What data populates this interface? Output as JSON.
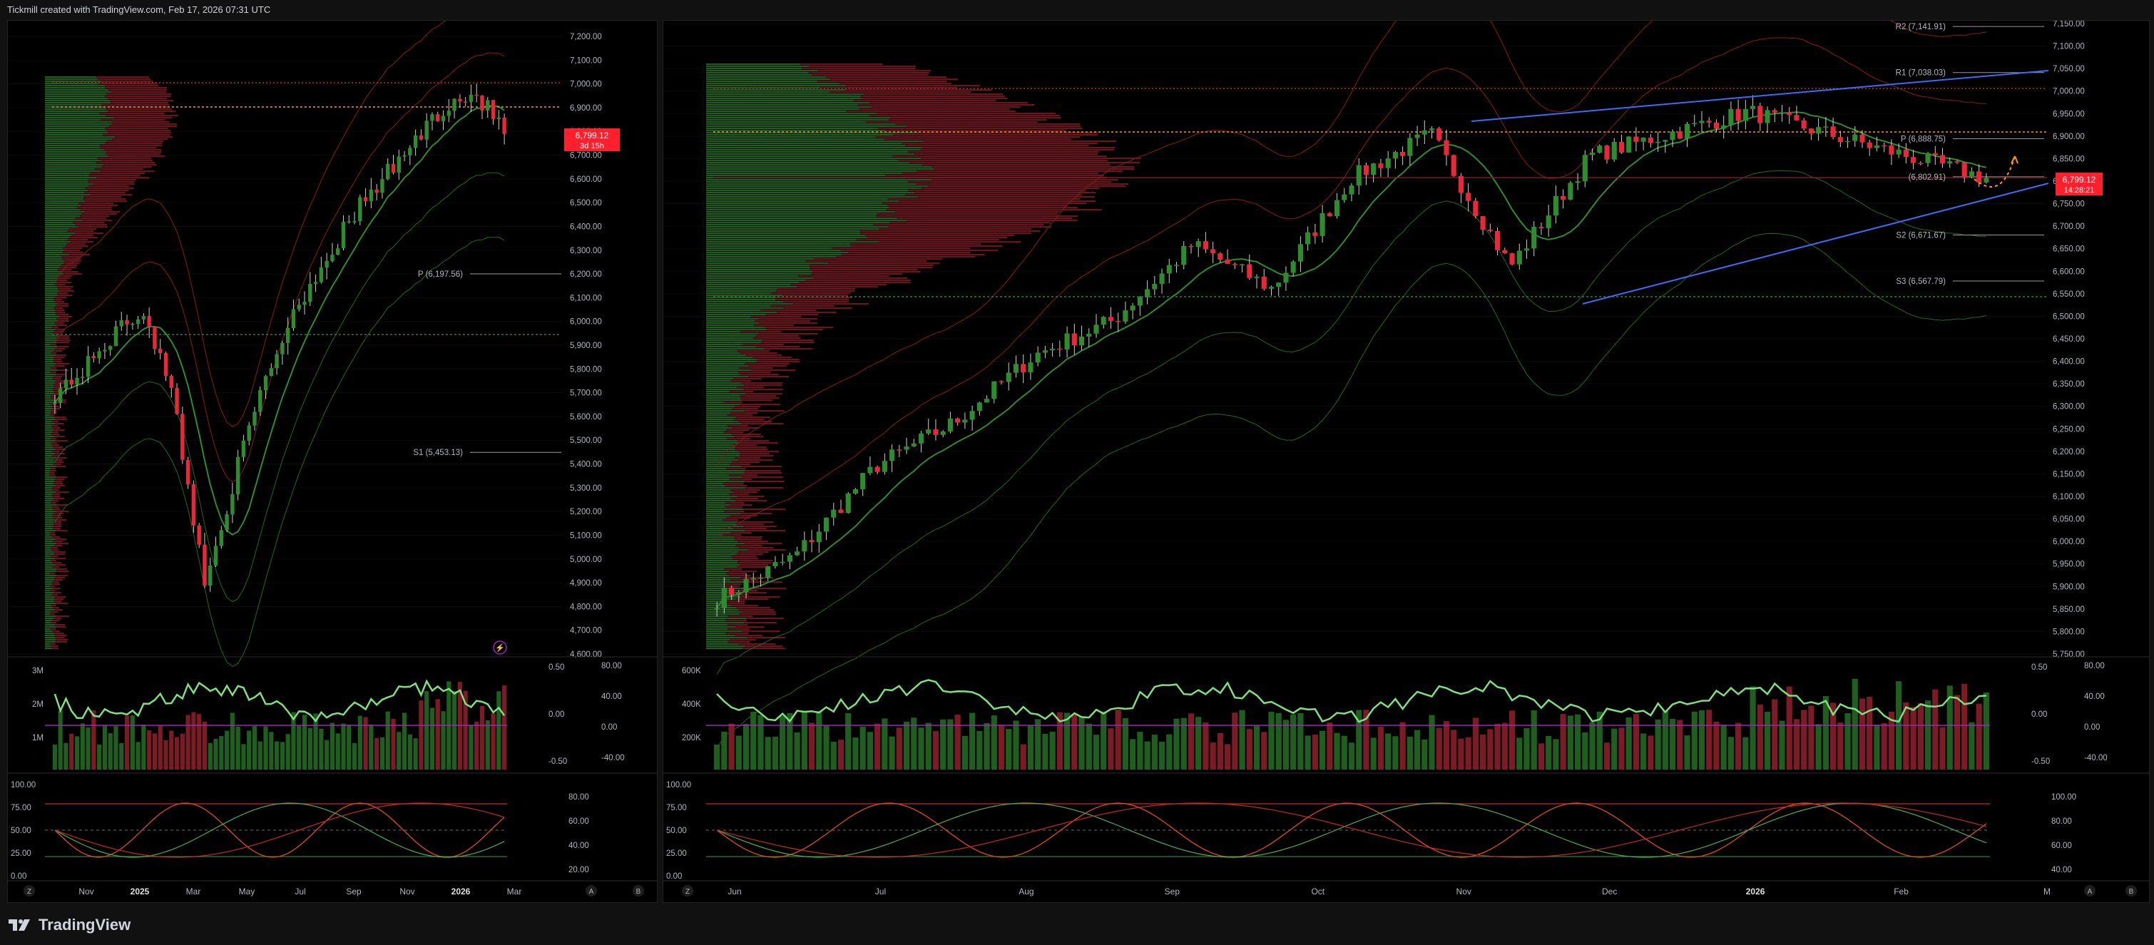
{
  "header": {
    "attribution": "Tickmill created with TradingView.com, Feb 17, 2026 07:31 UTC"
  },
  "footer": {
    "brand": "TradingView"
  },
  "colors": {
    "up": "#2e8b2e",
    "down": "#e8283a",
    "accent_red": "#ff1f2d",
    "pivot_orange": "#ff9800",
    "trend_blue": "#3b6cf6",
    "rsi_green": "#7ee07e"
  },
  "left_chart": {
    "price_axis": [
      "7,200.00",
      "7,100.00",
      "7,000.00",
      "6,900.00",
      "6,800.00",
      "6,700.00",
      "6,600.00",
      "6,500.00",
      "6,400.00",
      "6,300.00",
      "6,200.00",
      "6,100.00",
      "6,000.00",
      "5,900.00",
      "5,800.00",
      "5,700.00",
      "5,600.00",
      "5,500.00",
      "5,400.00",
      "5,300.00",
      "5,200.00",
      "5,100.00",
      "5,000.00",
      "4,900.00",
      "4,800.00",
      "4,700.00",
      "4,600.00"
    ],
    "price_min": 4600,
    "price_max": 7200,
    "pivots": [
      {
        "label": "P (6,197.56)",
        "value": 6197.56
      },
      {
        "label": "S1 (5,453.13)",
        "value": 5453.13
      }
    ],
    "last_price": "6,799.12",
    "countdown": "3d 15h",
    "volume_axis": [
      "3M",
      "2M",
      "1M"
    ],
    "osc_axis": [
      "0.50",
      "0.00",
      "-0.50"
    ],
    "osc_axis2": [
      "80.00",
      "40.00",
      "0.00",
      "-40.00"
    ],
    "stoch_axis": [
      "100.00",
      "75.00",
      "50.00",
      "25.00",
      "0.00"
    ],
    "stoch_axis2": [
      "80.00",
      "60.00",
      "40.00",
      "20.00"
    ],
    "time_axis": [
      "Nov",
      "2025",
      "Mar",
      "May",
      "Jul",
      "Sep",
      "Nov",
      "2026",
      "Mar"
    ],
    "corner_labels": [
      "Z",
      "A",
      "B"
    ]
  },
  "right_chart": {
    "price_axis": [
      "7,150.00",
      "7,100.00",
      "7,050.00",
      "7,000.00",
      "6,950.00",
      "6,900.00",
      "6,850.00",
      "6,800.00",
      "6,750.00",
      "6,700.00",
      "6,650.00",
      "6,600.00",
      "6,550.00",
      "6,500.00",
      "6,450.00",
      "6,400.00",
      "6,350.00",
      "6,300.00",
      "6,250.00",
      "6,200.00",
      "6,150.00",
      "6,100.00",
      "6,050.00",
      "6,000.00",
      "5,950.00",
      "5,900.00",
      "5,850.00",
      "5,800.00",
      "5,750.00"
    ],
    "price_min": 5720,
    "price_max": 7155,
    "pivots": [
      {
        "label": "R2 (7,141.91)",
        "value": 7141.91
      },
      {
        "label": "R1 (7,038.03)",
        "value": 7038.03
      },
      {
        "label": "P (6,888.75)",
        "value": 6888.75
      },
      {
        "label": "(6,802.91)",
        "value": 6802.91
      },
      {
        "label": "S2 (6,671.67)",
        "value": 6671.67
      },
      {
        "label": "S3 (6,567.79)",
        "value": 6567.79
      }
    ],
    "last_price": "6,799.12",
    "countdown": "14:28:21",
    "volume_axis": [
      "600K",
      "400K",
      "200K"
    ],
    "osc_axis": [
      "0.50",
      "0.00",
      "-0.50"
    ],
    "osc_axis2": [
      "80.00",
      "40.00",
      "0.00",
      "-40.00"
    ],
    "stoch_axis": [
      "100.00",
      "75.00",
      "50.00",
      "25.00",
      "0.00"
    ],
    "stoch_axis2": [
      "100.00",
      "80.00",
      "60.00",
      "40.00"
    ],
    "time_axis": [
      "Jun",
      "Jul",
      "Aug",
      "Sep",
      "Oct",
      "Nov",
      "Dec",
      "2026",
      "Feb",
      "M"
    ],
    "corner_labels": [
      "Z",
      "A",
      "B"
    ]
  }
}
